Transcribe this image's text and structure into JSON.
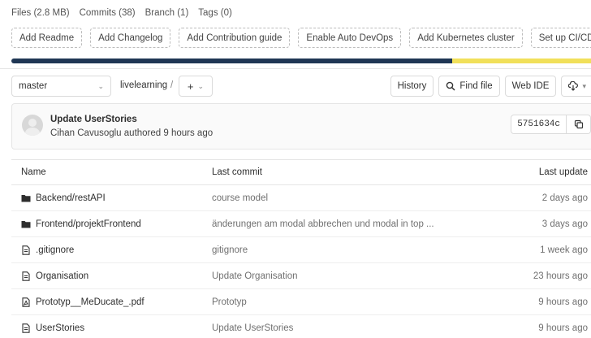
{
  "stats": {
    "files": "Files (2.8 MB)",
    "commits": "Commits (38)",
    "branch": "Branch (1)",
    "tags": "Tags (0)"
  },
  "actions": [
    "Add Readme",
    "Add Changelog",
    "Add Contribution guide",
    "Enable Auto DevOps",
    "Add Kubernetes cluster",
    "Set up CI/CD"
  ],
  "language_bar": {
    "segments": [
      {
        "color": "#1f3654",
        "fraction": 0.76
      },
      {
        "color": "#f1e05a",
        "fraction": 0.24
      }
    ]
  },
  "nav": {
    "branch": "master",
    "path": "livelearning",
    "separator": "/",
    "add": "+",
    "history": "History",
    "find_file": "Find file",
    "web_ide": "Web IDE"
  },
  "commit": {
    "title": "Update UserStories",
    "meta": "Cihan Cavusoglu authored 9 hours ago",
    "sha": "5751634c"
  },
  "table": {
    "headers": {
      "name": "Name",
      "last_commit": "Last commit",
      "last_update": "Last update"
    },
    "rows": [
      {
        "type": "folder",
        "name": "Backend/restAPI",
        "commit": "course model",
        "date": "2 days ago"
      },
      {
        "type": "folder",
        "name": "Frontend/projektFrontend",
        "commit": "änderungen am modal abbrechen und modal in top ...",
        "date": "3 days ago"
      },
      {
        "type": "file",
        "name": ".gitignore",
        "commit": "gitignore",
        "date": "1 week ago"
      },
      {
        "type": "file",
        "name": "Organisation",
        "commit": "Update Organisation",
        "date": "23 hours ago"
      },
      {
        "type": "pdf",
        "name": "Prototyp__MeDucate_.pdf",
        "commit": "Prototyp",
        "date": "9 hours ago"
      },
      {
        "type": "file",
        "name": "UserStories",
        "commit": "Update UserStories",
        "date": "9 hours ago"
      }
    ]
  }
}
